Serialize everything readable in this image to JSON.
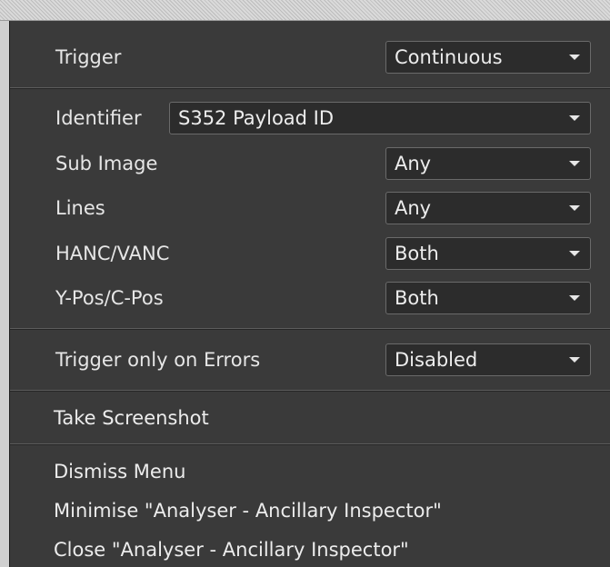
{
  "menu": {
    "trigger": {
      "label": "Trigger",
      "value": "Continuous"
    },
    "identifier": {
      "label": "Identifier",
      "value": "S352 Payload ID"
    },
    "sub_image": {
      "label": "Sub Image",
      "value": "Any"
    },
    "lines": {
      "label": "Lines",
      "value": "Any"
    },
    "hanc_vanc": {
      "label": "HANC/VANC",
      "value": "Both"
    },
    "ypos_cpos": {
      "label": "Y-Pos/C-Pos",
      "value": "Both"
    },
    "trigger_errors": {
      "label": "Trigger only on Errors",
      "value": "Disabled"
    },
    "take_screenshot": "Take Screenshot",
    "dismiss_menu": "Dismiss Menu",
    "minimise": "Minimise \"Analyser - Ancillary Inspector\"",
    "close": "Close \"Analyser - Ancillary Inspector\""
  }
}
